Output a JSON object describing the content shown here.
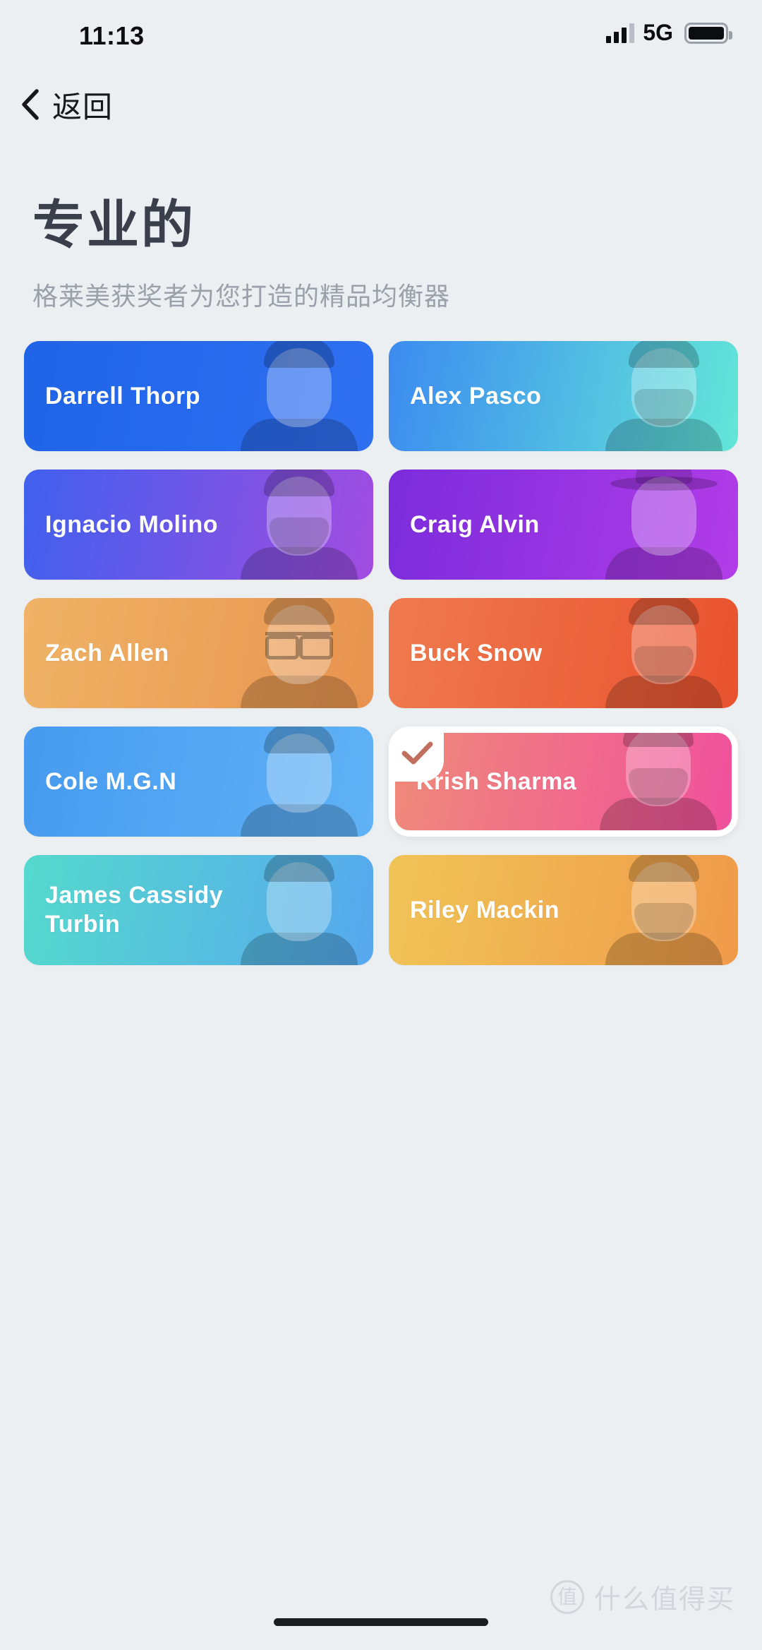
{
  "status_bar": {
    "time": "11:13",
    "network": "5G",
    "signal_icon": "cellular-signal-icon",
    "battery_icon": "battery-full-icon"
  },
  "nav": {
    "back_label": "返回",
    "back_icon": "chevron-left-icon"
  },
  "header": {
    "title": "专业的",
    "subtitle": "格莱美获奖者为您打造的精品均衡器"
  },
  "selection": {
    "selected_name": "Krish Sharma",
    "check_icon": "check-icon",
    "check_color": "#c1705f"
  },
  "presets": [
    {
      "name": "Darrell Thorp",
      "gradient_from": "#1f64e8",
      "gradient_to": "#2f6ff0",
      "selected": false,
      "face": "plain"
    },
    {
      "name": "Alex Pasco",
      "gradient_from": "#3c8bf0",
      "gradient_to": "#63e6d8",
      "selected": false,
      "face": "beard"
    },
    {
      "name": "Ignacio Molino",
      "gradient_from": "#4060ee",
      "gradient_to": "#a24ce0",
      "selected": false,
      "face": "beard"
    },
    {
      "name": "Craig Alvin",
      "gradient_from": "#7b2cdc",
      "gradient_to": "#b23ce8",
      "selected": false,
      "face": "hat"
    },
    {
      "name": "Zach Allen",
      "gradient_from": "#efb366",
      "gradient_to": "#e8934f",
      "selected": false,
      "face": "glasses"
    },
    {
      "name": "Buck Snow",
      "gradient_from": "#ef7a4e",
      "gradient_to": "#e9522f",
      "selected": false,
      "face": "beard"
    },
    {
      "name": "Cole M.G.N",
      "gradient_from": "#479bf0",
      "gradient_to": "#5fb2f5",
      "selected": false,
      "face": "plain"
    },
    {
      "name": "Krish Sharma",
      "gradient_from": "#ef8a7a",
      "gradient_to": "#f0509c",
      "selected": true,
      "face": "beard"
    },
    {
      "name": "James Cassidy Turbin",
      "gradient_from": "#55d9cd",
      "gradient_to": "#56a8ee",
      "selected": false,
      "face": "plain"
    },
    {
      "name": "Riley Mackin",
      "gradient_from": "#f0c457",
      "gradient_to": "#f09a4a",
      "selected": false,
      "face": "beard"
    }
  ],
  "watermark": {
    "logo_text": "值",
    "text": "什么值得买"
  }
}
